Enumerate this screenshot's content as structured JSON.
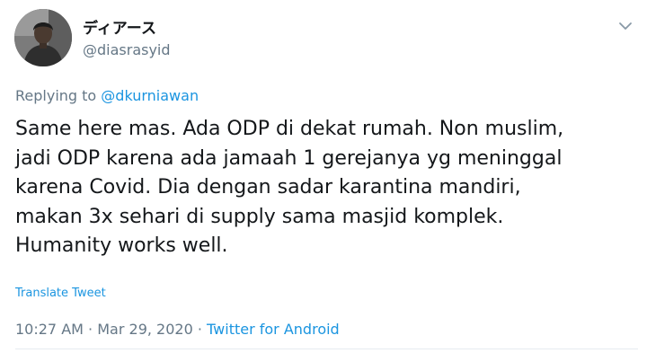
{
  "author": {
    "name": "ディアース",
    "handle": "@diasrasyid"
  },
  "reply": {
    "prefix": "Replying to",
    "handle": "@dkurniawan"
  },
  "tweet": {
    "lines": [
      "Same here mas. Ada ODP di dekat rumah. Non muslim,",
      "jadi ODP karena ada jamaah 1 gerejanya yg meninggal",
      "karena Covid. Dia dengan sadar karantina mandiri,",
      "makan 3x sehari di supply sama masjid komplek.",
      "Humanity works well."
    ],
    "translate_label": "Translate Tweet",
    "time": "10:27 AM",
    "date": "Mar 29, 2020",
    "separator": "·",
    "source": "Twitter for Android"
  },
  "icons": {
    "avatar": "user-avatar",
    "menu": "chevron-down-icon"
  },
  "colors": {
    "text": "#14171a",
    "secondary": "#657786",
    "link": "#1b95e0"
  }
}
